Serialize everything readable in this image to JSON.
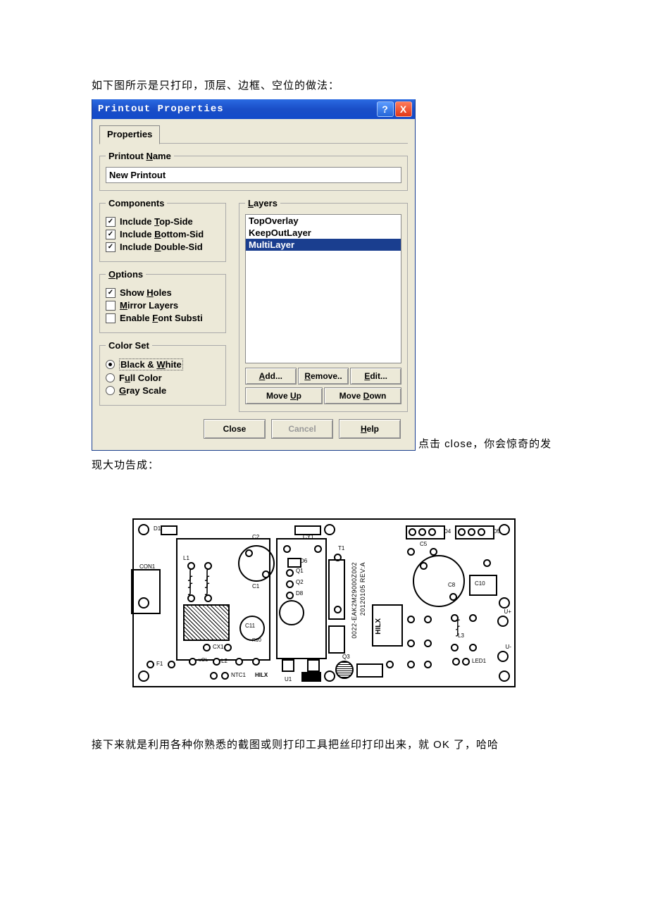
{
  "intro": "如下图所示是只打印，顶层、边框、空位的做法：",
  "dialog": {
    "title": "Printout Properties",
    "tab": "Properties",
    "name_group": "Printout Name",
    "name_value": "New Printout",
    "components": {
      "legend": "Components",
      "top": "Include Top-Side",
      "top_u": "T",
      "bottom": "Include Bottom-Sid",
      "bottom_u": "B",
      "double": "Include Double-Sid",
      "double_u": "D"
    },
    "options": {
      "legend": "Options",
      "holes": "Show Holes",
      "holes_u": "H",
      "mirror": "Mirror Layers",
      "mirror_u": "M",
      "font": "Enable Font Substi",
      "font_u": "F"
    },
    "colorset": {
      "legend": "Color Set",
      "bw": "Black & White",
      "bw_u": "W",
      "full": "Full Color",
      "full_u": "u",
      "gray": "Gray Scale",
      "gray_u": "G"
    },
    "layers": {
      "legend": "Layers",
      "items": [
        "TopOverlay",
        "KeepOutLayer",
        "MultiLayer"
      ],
      "selected": 2,
      "add": "Add...",
      "add_u": "A",
      "remove": "Remove..",
      "remove_u": "R",
      "edit": "Edit...",
      "edit_u": "E",
      "moveup": "Move Up",
      "moveup_u": "U",
      "movedown": "Move Down",
      "movedown_u": "D"
    },
    "footer": {
      "close": "Close",
      "cancel": "Cancel",
      "help": "Help",
      "help_u": "H"
    }
  },
  "after_dialog_1": "点击 close，你会惊奇的发",
  "after_dialog_2": "现大功告成：",
  "pcb": {
    "labels": {
      "D1": "D1",
      "C2": "C2",
      "CY1": "CY1",
      "T1": "T1",
      "CON1": "CON1",
      "L1": "L1",
      "C1": "C1",
      "D6": "D6",
      "Q1": "Q1",
      "Q2": "Q2",
      "D8": "D8",
      "C5": "C5",
      "C11": "C11",
      "R10": "R10",
      "CX1": "CX1",
      "C8": "C8",
      "C10": "C10",
      "L2": "L2",
      "Q3": "Q3",
      "L3": "L3",
      "F1": "F1",
      "NTC1": "NTC1",
      "U1": "U1",
      "LED1": "LED1",
      "D4": "D4",
      "D5": "D5",
      "U": "U+",
      "Um": "U-",
      "code1": "0022-EAK2M29000Z002",
      "code2": "20120105 REV:A",
      "logo": "HILX"
    }
  },
  "final": "接下来就是利用各种你熟悉的截图或则打印工具把丝印打印出来，就 OK 了，哈哈"
}
